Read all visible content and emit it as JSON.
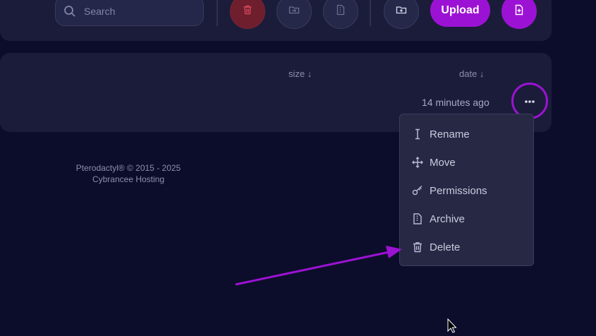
{
  "toolbar": {
    "search_placeholder": "Search",
    "upload_label": "Upload",
    "buttons": [
      {
        "icon": "trash-icon"
      },
      {
        "icon": "move-folder-icon"
      },
      {
        "icon": "archive-file-icon"
      },
      {
        "icon": "new-folder-icon"
      },
      {
        "icon": "new-file-icon"
      }
    ]
  },
  "file_list": {
    "columns": {
      "size": "size ↓",
      "date": "date ↓"
    },
    "rows": [
      {
        "date": "14 minutes ago"
      }
    ]
  },
  "context_menu": {
    "items": [
      {
        "label": "Rename",
        "icon": "text-cursor-icon"
      },
      {
        "label": "Move",
        "icon": "move-arrows-icon"
      },
      {
        "label": "Permissions",
        "icon": "key-icon"
      },
      {
        "label": "Archive",
        "icon": "archive-file-icon"
      },
      {
        "label": "Delete",
        "icon": "trash-icon"
      }
    ]
  },
  "footer": {
    "copyright": "Pterodactyl® © 2015 - 2025",
    "host": "Cybrancee Hosting"
  },
  "colors": {
    "background": "#0c0d2a",
    "card": "#1b1c3a",
    "accent": "#9c12d4",
    "danger": "#6e1e2c"
  }
}
